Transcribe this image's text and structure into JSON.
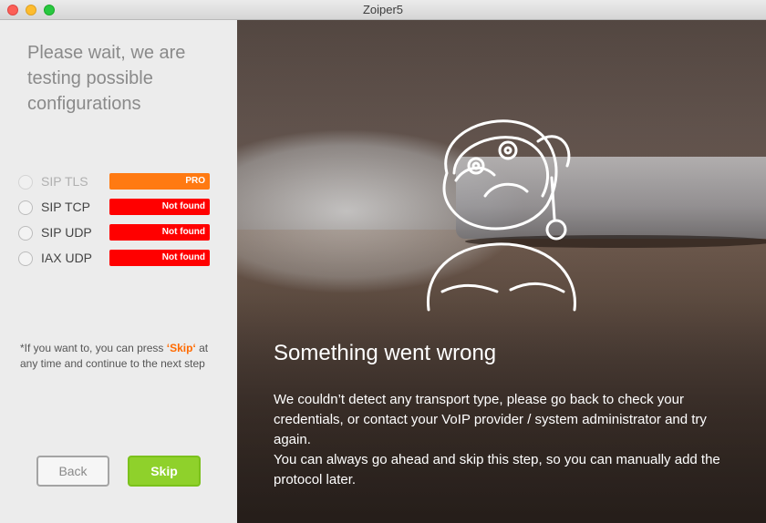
{
  "window": {
    "title": "Zoiper5"
  },
  "left_panel": {
    "heading": "Please wait, we are testing possible configurations",
    "protocols": [
      {
        "label": "SIP TLS",
        "status": "PRO",
        "state": "pro"
      },
      {
        "label": "SIP TCP",
        "status": "Not found",
        "state": "fail"
      },
      {
        "label": "SIP UDP",
        "status": "Not found",
        "state": "fail"
      },
      {
        "label": "IAX UDP",
        "status": "Not found",
        "state": "fail"
      }
    ],
    "note_prefix": "*If you want to, you can press ",
    "note_skip": "‘Skip‘",
    "note_suffix": " at any time and continue to the next step",
    "back_label": "Back",
    "skip_label": "Skip"
  },
  "right_panel": {
    "headline": "Something went wrong",
    "paragraph1": "We couldn’t detect any transport type, please go back to check your credentials, or contact your VoIP provider / system administrator and try again.",
    "paragraph2": "You can always go ahead and skip this step, so you can manually add the protocol later."
  },
  "colors": {
    "pro": "#ff7a12",
    "fail": "#ff0000",
    "skip_accent": "#ff6a00",
    "skip_button": "#8fd12b"
  },
  "icons": {
    "astronaut": "sad-astronaut-illustration"
  }
}
